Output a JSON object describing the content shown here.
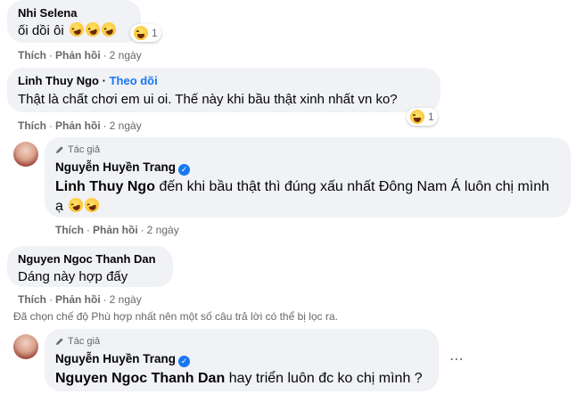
{
  "comments": [
    {
      "name": "Nhi Selena",
      "text": "ối dồi ôi",
      "reaction_count": "1",
      "time": "2 ngày"
    },
    {
      "name": "Linh Thuy Ngo",
      "follow": "Theo dõi",
      "text": "Thật là chất chơi em ui oi. Thế này khi bầu thật xinh nhất vn ko?",
      "reaction_count": "1",
      "time": "2 ngày"
    },
    {
      "author_label": "Tác giả",
      "name": "Nguyễn Huyền Trang",
      "mention": "Linh Thuy Ngo",
      "text_line1": "đến khi bầu thật thì đúng xấu nhất Đông Nam Á luôn chị mình",
      "text_line2": "ạ",
      "time": "2 ngày"
    },
    {
      "name": "Nguyen Ngoc Thanh Dan",
      "text": "Dáng này hợp đấy",
      "time": "2 ngày"
    },
    {
      "author_label": "Tác giả",
      "name": "Nguyễn Huyền Trang",
      "mention": "Nguyen Ngoc Thanh Dan",
      "text": "hay triển luôn đc ko chị mình ?"
    }
  ],
  "actions": {
    "like": "Thích",
    "reply": "Phản hồi",
    "separator": "·"
  },
  "filter_note": "Đã chọn chế độ Phù hợp nhất nên một số câu trả lời có thể bị lọc ra.",
  "more_icon": "⋯",
  "colors": {
    "bubble": "#f0f2f5",
    "link": "#1877f2",
    "meta": "#65676b"
  }
}
